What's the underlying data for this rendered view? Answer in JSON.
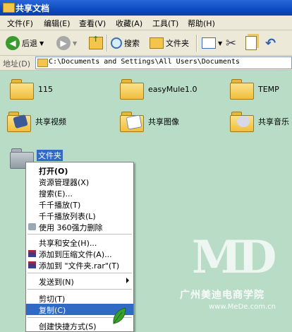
{
  "window": {
    "title": "共享文档"
  },
  "menubar": [
    {
      "label": "文件(F)"
    },
    {
      "label": "编辑(E)"
    },
    {
      "label": "查看(V)"
    },
    {
      "label": "收藏(A)"
    },
    {
      "label": "工具(T)"
    },
    {
      "label": "帮助(H)"
    }
  ],
  "toolbar": {
    "back_label": "后退",
    "search_label": "搜索",
    "folders_label": "文件夹"
  },
  "address": {
    "label": "地址(D)",
    "value": "C:\\Documents and Settings\\All Users\\Documents"
  },
  "items": [
    {
      "label": "115"
    },
    {
      "label": "easyMule1.0"
    },
    {
      "label": "TEMP"
    },
    {
      "label": "共享视频"
    },
    {
      "label": "共享图像"
    },
    {
      "label": "共享音乐"
    },
    {
      "label": "文件夹"
    }
  ],
  "context_menu": [
    {
      "label": "打开(O)"
    },
    {
      "label": "资源管理器(X)"
    },
    {
      "label": "搜索(E)..."
    },
    {
      "label": "千千播放(T)"
    },
    {
      "label": "千千播放列表(L)"
    },
    {
      "label": "使用 360强力删除"
    },
    {
      "label": "共享和安全(H)..."
    },
    {
      "label": "添加到压缩文件(A)..."
    },
    {
      "label": "添加到 \"文件夹.rar\"(T)"
    },
    {
      "label": "发送到(N)"
    },
    {
      "label": "剪切(T)"
    },
    {
      "label": "复制(C)"
    },
    {
      "label": "创建快捷方式(S)"
    }
  ],
  "watermark": {
    "logo": "MD",
    "text": "广州美迪电商学院",
    "url": "www.MeDe.com.cn"
  },
  "colors": {
    "accent": "#316ac5",
    "background": "#b9dcc7",
    "titlebar": "#0b4bc2"
  }
}
